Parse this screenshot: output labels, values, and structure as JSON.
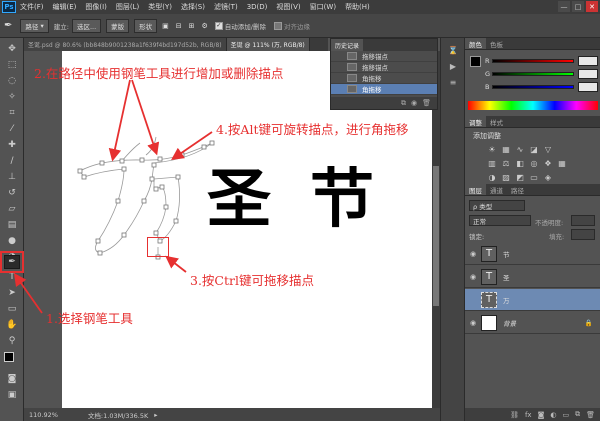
{
  "menubar": {
    "logo": "Ps",
    "items": [
      "文件(F)",
      "编辑(E)",
      "图像(I)",
      "图层(L)",
      "类型(Y)",
      "选择(S)",
      "滤镜(T)",
      "3D(D)",
      "视图(V)",
      "窗口(W)",
      "帮助(H)"
    ],
    "win_min": "—",
    "win_max": "□",
    "win_close": "✕"
  },
  "options": {
    "mode": "路径",
    "build_label": "建立:",
    "select": "选区...",
    "mask": "蒙版",
    "shape": "形状",
    "auto_add": "自动添加/删除",
    "align_edges": "对齐边缘"
  },
  "tabs": [
    {
      "label": "圣诞.psd @ 80.6% (bb848b9001238a1f639f4bd197d52b, RGB/8)"
    },
    {
      "label": "圣诞 @ 111% (万, RGB/8)"
    }
  ],
  "history": {
    "tab": "历史记录",
    "items": [
      "拖移锚点",
      "拖移锚点",
      "角拖移",
      "角拖移"
    ],
    "selected_index": 3
  },
  "canvas": {
    "chars": [
      "圣",
      "节"
    ],
    "outline_char": "万"
  },
  "annotations": {
    "a1": "1.选择钢笔工具",
    "a2": "2.在路径中使用钢笔工具进行增加或删除描点",
    "a3": "3.按Ctrl键可拖移描点",
    "a4": "4.按Alt键可旋转描点，进行角拖移"
  },
  "status": {
    "zoom": "110.92%",
    "doc": "文档:1.03M/336.5K"
  },
  "color_panel": {
    "tabs": [
      "颜色",
      "色板"
    ],
    "r_label": "R",
    "g_label": "G",
    "b_label": "B",
    "r": "",
    "g": "",
    "b": ""
  },
  "adjust_panel": {
    "tabs": [
      "调整",
      "样式"
    ],
    "title": "添加调整"
  },
  "layers_panel": {
    "tabs": [
      "图层",
      "通道",
      "路径"
    ],
    "filter": "ρ 类型",
    "blend": "正常",
    "opacity_label": "不透明度:",
    "lock_label": "锁定:",
    "fill_label": "填充:",
    "layers": [
      {
        "name": "节",
        "thumb": "T"
      },
      {
        "name": "圣",
        "thumb": "T"
      },
      {
        "name": "万",
        "thumb": "T"
      },
      {
        "name": "背景",
        "thumb": ""
      }
    ],
    "selected_index": 2
  },
  "colors": {
    "accent": "#e63030",
    "selection": "#6d8ab3",
    "fg": "#000000",
    "bg": "#e8780a"
  }
}
